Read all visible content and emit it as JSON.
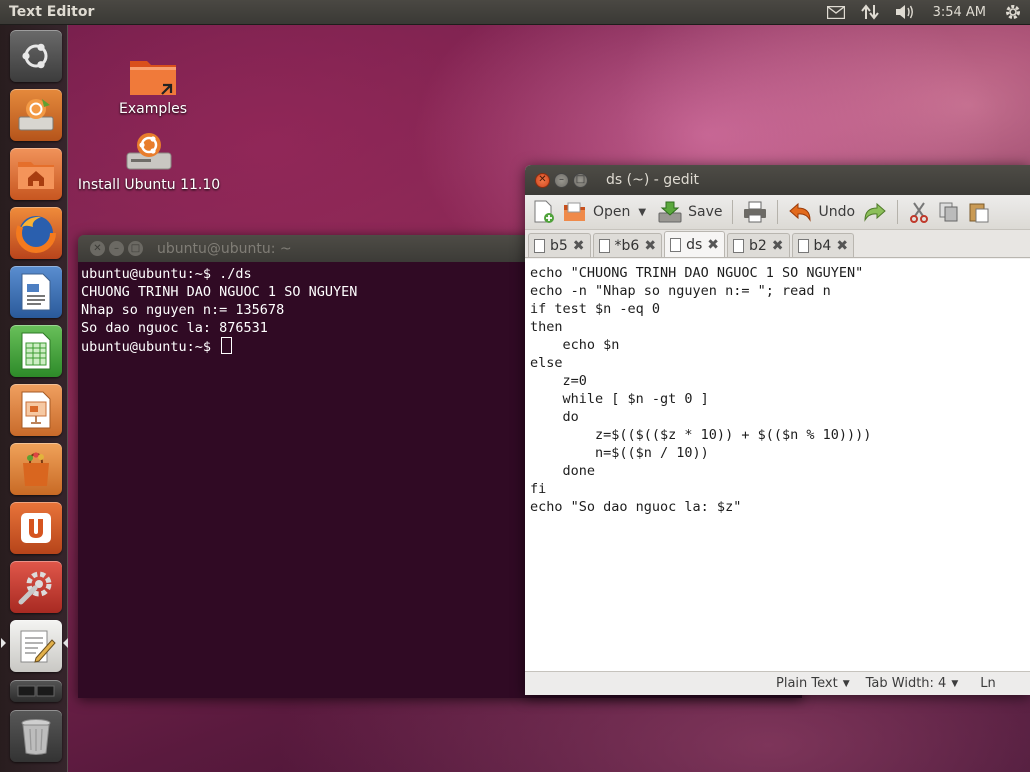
{
  "top_panel": {
    "title": "Text Editor",
    "clock": "3:54 AM"
  },
  "desktop": {
    "icons": [
      {
        "label": "Examples",
        "icon": "folder-examples-icon"
      },
      {
        "label": "Install Ubuntu 11.10",
        "icon": "install-ubuntu-icon"
      }
    ]
  },
  "launcher": {
    "items": [
      "dash-home",
      "ubuntu-installer",
      "files-home",
      "firefox",
      "libreoffice-writer",
      "libreoffice-calc",
      "libreoffice-impress",
      "software-center",
      "ubuntu-one",
      "system-settings",
      "gedit-text-editor",
      "workspaces",
      "trash"
    ]
  },
  "terminal": {
    "title": "ubuntu@ubuntu: ~",
    "lines": [
      "ubuntu@ubuntu:~$ ./ds",
      "CHUONG TRINH DAO NGUOC 1 SO NGUYEN",
      "Nhap so nguyen n:= 135678",
      "So dao nguoc la: 876531"
    ],
    "prompt": "ubuntu@ubuntu:~$ "
  },
  "gedit": {
    "title": "ds (~) - gedit",
    "toolbar": {
      "open_label": "Open",
      "save_label": "Save",
      "undo_label": "Undo"
    },
    "tabs": [
      {
        "label": "b5",
        "active": false
      },
      {
        "label": "*b6",
        "active": false
      },
      {
        "label": "ds",
        "active": true
      },
      {
        "label": "b2",
        "active": false
      },
      {
        "label": "b4",
        "active": false
      }
    ],
    "lines": [
      "echo \"CHUONG TRINH DAO NGUOC 1 SO NGUYEN\"",
      "echo -n \"Nhap so nguyen n:= \"; read n",
      "if test $n -eq 0",
      "then",
      "    echo $n",
      "else",
      "    z=0",
      "    while [ $n -gt 0 ]",
      "    do",
      "        z=$(($(($z * 10)) + $(($n % 10))))",
      "        n=$(($n / 10))",
      "    done",
      "fi",
      "echo \"So dao nguoc la: $z\""
    ],
    "status": {
      "language": "Plain Text",
      "tab_width": "Tab Width: 4",
      "position": "Ln"
    }
  },
  "colors": {
    "terminal_bg": "#300a24",
    "close_button": "#e0552a",
    "panel_bg": "#3c3b37"
  }
}
